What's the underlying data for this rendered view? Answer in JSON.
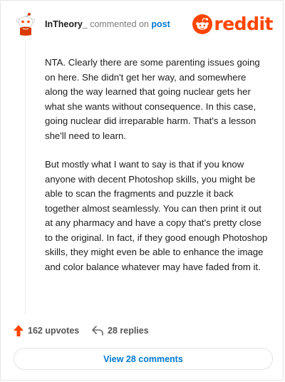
{
  "comment": {
    "username": "InTheory_",
    "action_text": "commented on",
    "post_link": "post",
    "paragraphs": [
      "NTA. Clearly there are some parenting issues going on here. She didn't get her way, and somewhere along the way learned that going nuclear gets her what she wants without consequence. In this case, going nuclear did irreparable harm. That's a lesson she'll need to learn.",
      "But mostly what I want to say is that if you know anyone with decent Photoshop skills, you might be able to scan the fragments and puzzle it back together almost seamlessly. You can then print it out at any pharmacy and have a copy that's pretty close to the original. In fact, if they good enough Photoshop skills, they might even be able to enhance the image and color balance whatever may have faded from it."
    ]
  },
  "brand": {
    "logo_text": "reddit",
    "logo_icon": "reddit-snoo-icon",
    "color": "#ff4500"
  },
  "avatar": {
    "icon": "snoo-avatar-icon"
  },
  "actions": {
    "upvotes_label": "162 upvotes",
    "replies_label": "28 replies",
    "upvote_icon": "upvote-arrow-icon",
    "reply_icon": "reply-arrow-icon",
    "upvote_color": "#ff4500"
  },
  "footer": {
    "view_comments_label": "View 28 comments",
    "link_color": "#0079d3"
  }
}
